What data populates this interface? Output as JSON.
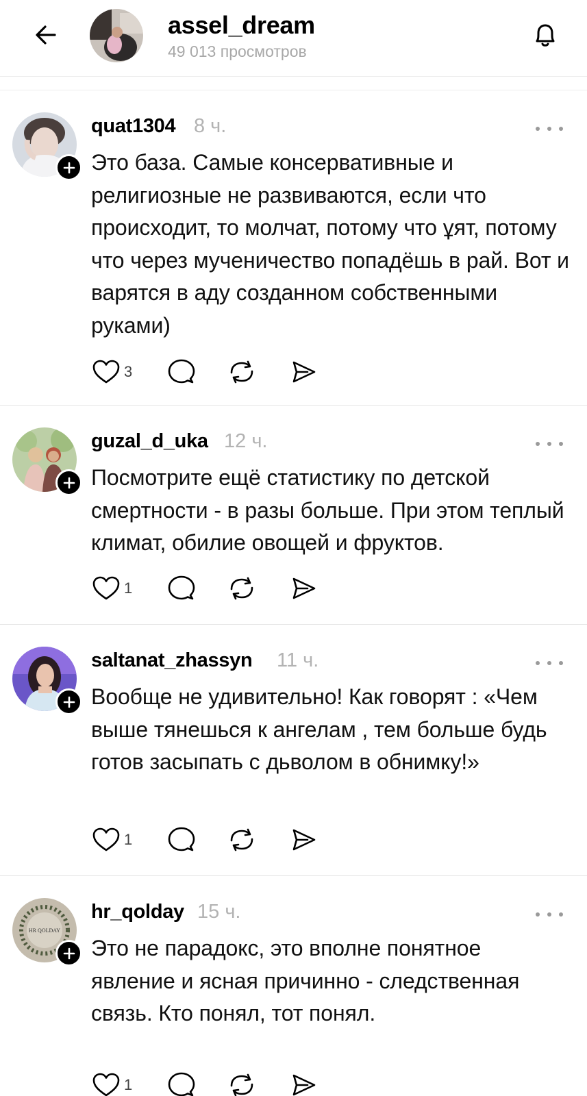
{
  "header": {
    "username": "assel_dream",
    "views": "49 013 просмотров",
    "back_icon": "arrow-left-icon",
    "bell_icon": "bell-icon"
  },
  "posts": [
    {
      "author": "quat1304",
      "time": "8 ч.",
      "text": "Это база. Самые консервативные и религиозные не развиваются, если что происходит, то молчат, потому что ұят, потому что через мученичество попадёшь в рай. Вот и варятся в аду созданном собственными руками)",
      "likes": "3"
    },
    {
      "author": "guzal_d_uka",
      "time": "12 ч.",
      "text": "Посмотрите ещё статистику по детской смертности - в разы больше. При этом теплый климат, обилие овощей и фруктов.",
      "likes": "1"
    },
    {
      "author": "saltanat_zhassyn",
      "time": "11 ч.",
      "text": "Вообще не удивительно! Как говорят : «Чем выше тянешься к ангелам , тем больше будь готов засыпать с дьволом в обнимку!»",
      "likes": "1"
    },
    {
      "author": "hr_qolday",
      "time": "15 ч.",
      "text": "Это не парадокс, это вполне понятное явление и ясная причинно - следственная связь. Кто понял, тот понял.",
      "likes": "1"
    }
  ],
  "logo_text": "HR QOLDAY",
  "colors": {
    "text": "#111111",
    "muted": "#b3b3b3",
    "divider": "#e4e4e4",
    "accent": "#000000"
  }
}
